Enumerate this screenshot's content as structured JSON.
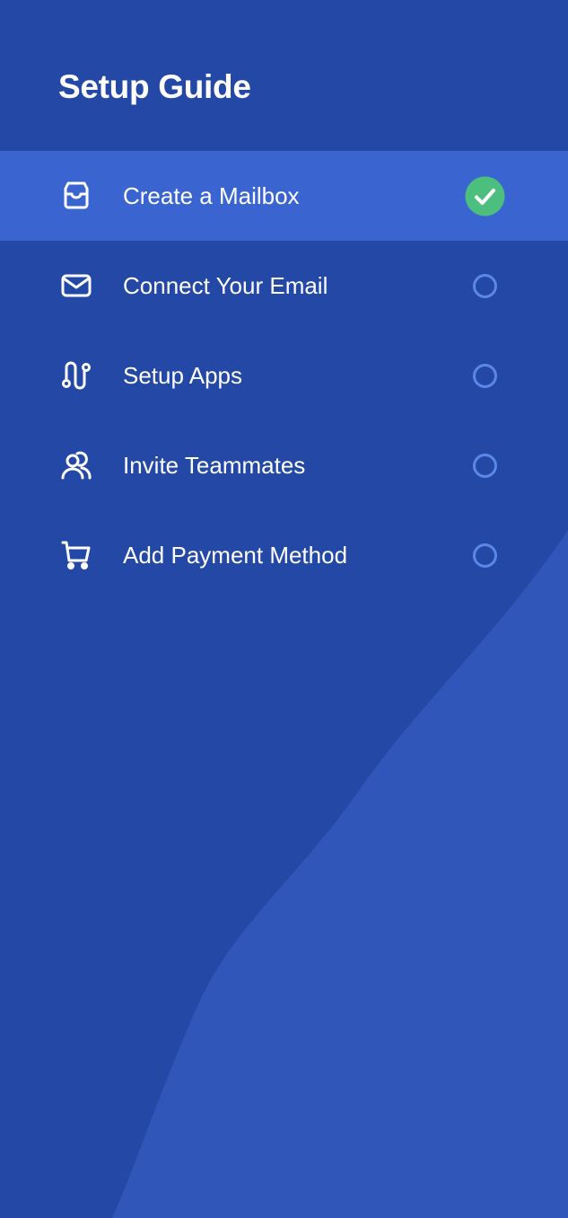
{
  "title": "Setup Guide",
  "colors": {
    "background": "#2448a6",
    "active_row": "#3a64d0",
    "complete": "#4cbf7e",
    "pending_ring": "#5b87e8",
    "wave": "#2f56b8"
  },
  "steps": [
    {
      "label": "Create a Mailbox",
      "icon": "inbox-icon",
      "status": "complete"
    },
    {
      "label": "Connect Your Email",
      "icon": "envelope-icon",
      "status": "pending"
    },
    {
      "label": "Setup Apps",
      "icon": "route-icon",
      "status": "pending"
    },
    {
      "label": "Invite Teammates",
      "icon": "users-icon",
      "status": "pending"
    },
    {
      "label": "Add Payment Method",
      "icon": "cart-icon",
      "status": "pending"
    }
  ]
}
